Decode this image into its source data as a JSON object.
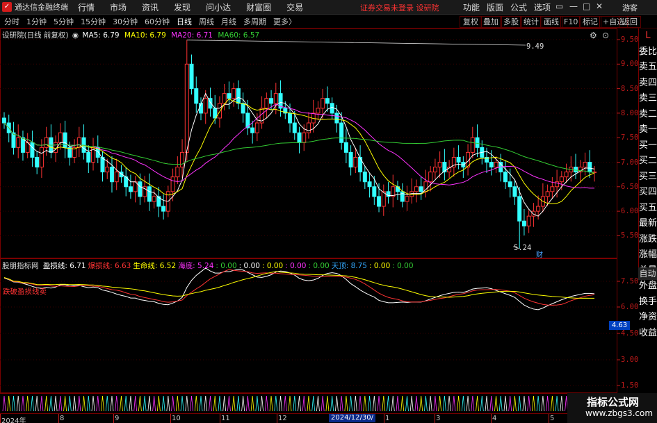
{
  "app": {
    "logo": "✓",
    "title": "通达信金融终端",
    "menu": [
      "行情",
      "市场",
      "资讯",
      "发现",
      "问小达",
      "财富圈",
      "交易"
    ],
    "notice": "证券交易未登录  设研院",
    "right_menu": [
      "功能",
      "版面",
      "公式",
      "选项"
    ],
    "guest": "游客"
  },
  "periods": [
    "分时",
    "1分钟",
    "5分钟",
    "15分钟",
    "30分钟",
    "60分钟",
    "日线",
    "周线",
    "月线",
    "多周期",
    "更多〉"
  ],
  "active_period": "日线",
  "toolbar": [
    "复权",
    "叠加",
    "多股",
    "统计",
    "画线",
    "F10",
    "标记",
    "+自选",
    "返回"
  ],
  "right_panel": [
    "L",
    "委比",
    "卖五",
    "卖四",
    "卖三",
    "卖二",
    "卖一",
    "买一",
    "买二",
    "买三",
    "买四",
    "买五",
    "最新",
    "涨跌",
    "涨幅",
    "总量",
    "外盘",
    "换手",
    "净资",
    "收益"
  ],
  "auto_label": "自动",
  "main_legend": {
    "title": "设研院(日线 前复权)",
    "ma": [
      {
        "label": "MA5: 6.79",
        "color": "#ffffff"
      },
      {
        "label": "MA10: 6.79",
        "color": "#ffff00"
      },
      {
        "label": "MA20: 6.71",
        "color": "#ff33ff"
      },
      {
        "label": "MA60: 6.57",
        "color": "#33cc33"
      }
    ]
  },
  "sub_legend": {
    "title": "股朋指标网",
    "items": [
      {
        "label": "盈损线: 6.71",
        "color": "#ffffff"
      },
      {
        "label": "爆损线: 6.63",
        "color": "#ff3333"
      },
      {
        "label": "生命线: 6.52",
        "color": "#ffff00"
      },
      {
        "label": "海底: 5.24",
        "color": "#ff33ff"
      },
      {
        "label": ": 0.00",
        "color": "#33cc33"
      },
      {
        "label": ": 0.00",
        "color": "#ffffff"
      },
      {
        "label": ": 0.00",
        "color": "#ffff00"
      },
      {
        "label": ": 0.00",
        "color": "#ff33ff"
      },
      {
        "label": ": 0.00",
        "color": "#33cc33"
      },
      {
        "label": "天顶: 8.75",
        "color": "#33aaff"
      },
      {
        "label": ": 0.00",
        "color": "#ffff00"
      },
      {
        "label": ": 0.00",
        "color": "#33cc33"
      }
    ],
    "note": "跌破盈损线卖"
  },
  "price_axis": [
    "9.50",
    "9.00",
    "8.50",
    "8.00",
    "7.50",
    "7.00",
    "6.50",
    "6.00",
    "5.50"
  ],
  "sub_axis": [
    "7.50",
    "6.00",
    "4.50",
    "3.00",
    "1.50"
  ],
  "price_tag": "4.63",
  "high_label": "9.49",
  "low_label": "5.24",
  "cai_label": "财",
  "dates": [
    "2024年",
    "8",
    "9",
    "10",
    "11",
    "12",
    "1",
    "3",
    "4",
    "5"
  ],
  "date_cursor": "2024/12/30/一",
  "watermark": {
    "line1": "指标公式网",
    "line2": "www.zbgs3.com"
  },
  "colors": {
    "up": "#ff3333",
    "down": "#33ffff",
    "ma5": "#ffffff",
    "ma10": "#ffff00",
    "ma20": "#ff33ff",
    "ma60": "#33cc33"
  },
  "chart_data": {
    "type": "candlestick",
    "close": [
      7.8,
      7.6,
      7.3,
      7.5,
      7.2,
      7.4,
      7.1,
      6.9,
      7.3,
      7.5,
      7.2,
      7.4,
      7.6,
      7.3,
      7.1,
      7.3,
      7.5,
      7.2,
      7.0,
      7.3,
      7.1,
      6.8,
      6.9,
      6.6,
      6.8,
      6.7,
      6.5,
      6.4,
      6.6,
      6.3,
      6.5,
      6.2,
      6.3,
      6.1,
      6.0,
      6.4,
      6.7,
      6.9,
      7.2,
      9.0,
      8.5,
      8.2,
      8.0,
      8.3,
      8.1,
      7.9,
      8.2,
      8.4,
      8.3,
      8.5,
      8.2,
      8.0,
      7.7,
      7.6,
      7.8,
      8.1,
      8.3,
      8.2,
      8.4,
      8.1,
      8.0,
      7.8,
      7.6,
      7.4,
      7.6,
      7.8,
      8.0,
      8.1,
      8.3,
      8.2,
      8.0,
      7.8,
      7.4,
      7.2,
      6.9,
      7.1,
      6.8,
      6.6,
      6.5,
      6.3,
      6.1,
      6.4,
      6.3,
      6.5,
      6.4,
      6.2,
      6.3,
      6.4,
      6.5,
      6.4,
      6.6,
      6.8,
      6.9,
      7.0,
      6.8,
      6.9,
      7.1,
      7.0,
      6.9,
      7.2,
      7.5,
      7.3,
      7.1,
      7.0,
      6.9,
      7.0,
      6.8,
      6.6,
      6.5,
      6.3,
      5.8,
      5.7,
      5.9,
      6.0,
      6.1,
      6.3,
      6.4,
      6.5,
      6.6,
      6.7,
      6.8,
      6.9,
      6.8,
      6.9,
      7.0,
      6.8,
      6.8
    ]
  }
}
